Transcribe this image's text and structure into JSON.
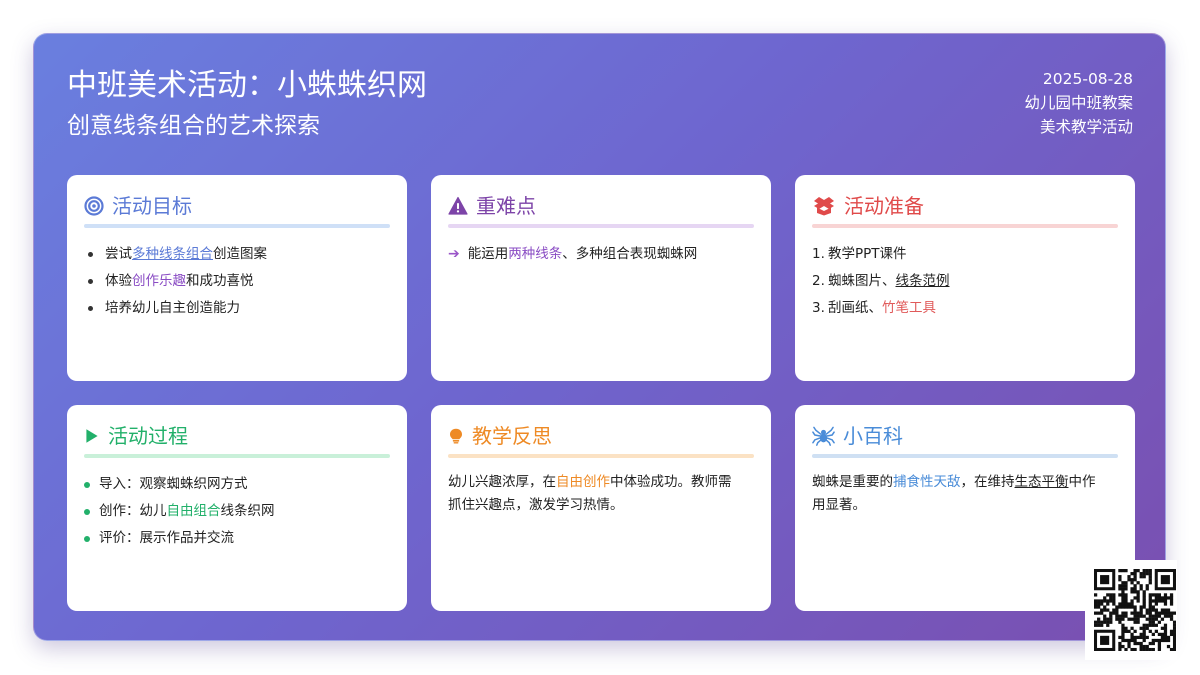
{
  "header": {
    "title": "中班美术活动：小蛛蛛织网",
    "subtitle": "创意线条组合的艺术探索",
    "date": "2025-08-28",
    "meta_line1": "幼儿园中班教案",
    "meta_line2": "美术教学活动"
  },
  "colors": {
    "goal": "#5b7ad6",
    "difficulty": "#7d44a8",
    "prep": "#e04a4a",
    "process": "#22b06a",
    "reflection": "#ee8a25",
    "encyclopedia": "#4a8cd8"
  },
  "cards": {
    "goal": {
      "heading": "活动目标",
      "items": [
        {
          "pre": "尝试",
          "hl": "多种线条组合",
          "post": "创造图案"
        },
        {
          "pre": "体验",
          "hl": "创作乐趣",
          "post": "和成功喜悦"
        },
        {
          "pre": "培养幼儿自主创造能力",
          "hl": "",
          "post": ""
        }
      ]
    },
    "difficulty": {
      "heading": "重难点",
      "item": {
        "pre": "能运用",
        "hl": "两种线条",
        "post": "、多种组合表现蜘蛛网"
      }
    },
    "prep": {
      "heading": "活动准备",
      "items": [
        {
          "num": "1.",
          "pre": "教学PPT课件",
          "hl": "",
          "post": ""
        },
        {
          "num": "2.",
          "pre": "蜘蛛图片、",
          "hl": "线条范例",
          "post": ""
        },
        {
          "num": "3.",
          "pre": "刮画纸、",
          "hl": "竹笔工具",
          "post": ""
        }
      ]
    },
    "process": {
      "heading": "活动过程",
      "items": [
        {
          "pre": "导入：观察蜘蛛织网方式",
          "hl": "",
          "post": ""
        },
        {
          "pre": "创作：幼儿",
          "hl": "自由组合",
          "post": "线条织网"
        },
        {
          "pre": "评价：展示作品并交流",
          "hl": "",
          "post": ""
        }
      ]
    },
    "reflection": {
      "heading": "教学反思",
      "pre": "幼儿兴趣浓厚，在",
      "hl": "自由创作",
      "post1": "中体验成功。教师需",
      "post2": "抓住兴趣点，激发学习热情。"
    },
    "encyclopedia": {
      "heading": "小百科",
      "pre": "蜘蛛是重要的",
      "hl1": "捕食性天敌",
      "mid": "，在维持",
      "hl2": "生态平衡",
      "post1": "中作",
      "post2": "用显著。"
    }
  }
}
